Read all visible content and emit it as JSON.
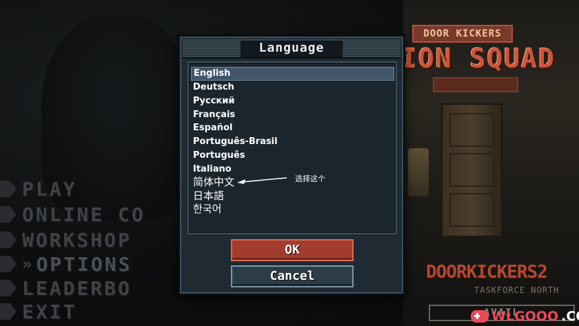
{
  "background": {
    "logo_top": "DOOR KICKERS",
    "logo_main": "ION SQUAD",
    "dk2_title": "DOORKICKERS2",
    "dk2_subtitle": "TASKFORCE NORTH",
    "available": "AVAIL"
  },
  "menu": {
    "items": [
      {
        "label": "PLAY"
      },
      {
        "label": "ONLINE CO"
      },
      {
        "label": "WORKSHOP"
      },
      {
        "label": "OPTIONS",
        "marker": "»"
      },
      {
        "label": "LEADERBO"
      },
      {
        "label": "EXIT"
      }
    ]
  },
  "dialog": {
    "title": "Language",
    "languages": [
      {
        "label": "English",
        "selected": true
      },
      {
        "label": "Deutsch"
      },
      {
        "label": "Русский"
      },
      {
        "label": "Français"
      },
      {
        "label": "Español"
      },
      {
        "label": "Português-Brasil"
      },
      {
        "label": "Português"
      },
      {
        "label": "Italiano"
      },
      {
        "label": "简体中文"
      },
      {
        "label": "日本語"
      },
      {
        "label": "한국어"
      }
    ],
    "ok_label": "OK",
    "cancel_label": "Cancel"
  },
  "annotation": {
    "text": "选择这个"
  },
  "watermark": {
    "prefix": "WLGOOO",
    "suffix": ".COM"
  },
  "colors": {
    "ok_button": "#a23c2e",
    "cancel_button": "#2d3d48",
    "selection_highlight": "#41566a",
    "dialog_bg": "#1f2a33"
  }
}
